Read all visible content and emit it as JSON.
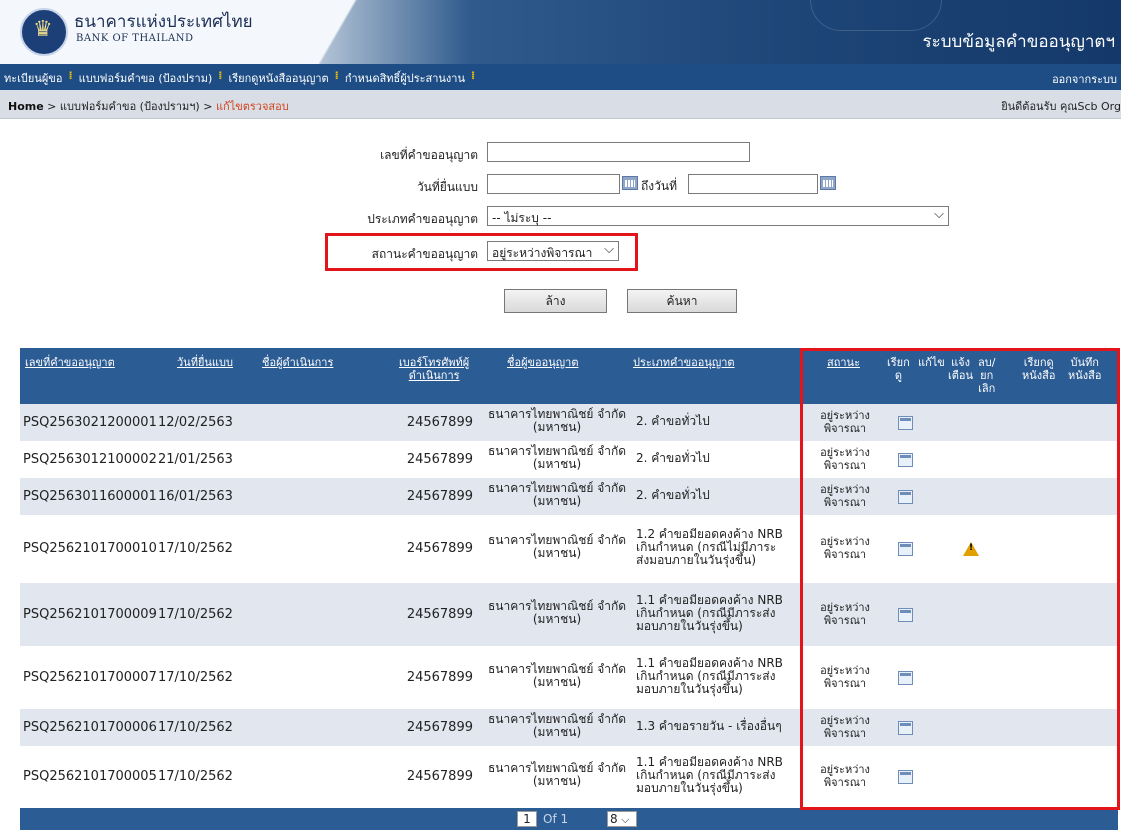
{
  "header": {
    "bank_name_th": "ธนาคารแห่งประเทศไทย",
    "bank_name_en": "BANK OF THAILAND",
    "system_title": "ระบบข้อมูลคำขออนุญาตฯ"
  },
  "nav": {
    "items": [
      "ทะเบียนผู้ขอ",
      "แบบฟอร์มคำขอ (ป้องปราม)",
      "เรียกดูหนังสืออนุญาต",
      "กำหนดสิทธิ์ผู้ประสานงาน"
    ],
    "logout": "ออกจากระบบ"
  },
  "breadcrumb": {
    "home": "Home",
    "sep": " > ",
    "level1": "แบบฟอร์มคำขอ (ป้องปรามฯ)",
    "current": "แก้ไขตรวจสอบ",
    "welcome": "ยินดีต้อนรับ  คุณScb Org"
  },
  "form": {
    "request_no_label": "เลขที่คำขออนุญาต",
    "request_no_value": "",
    "submit_date_label": "วันที่ยื่นแบบ",
    "date_from_value": "",
    "to_date_label": "ถึงวันที่",
    "date_to_value": "",
    "request_type_label": "ประเภทคำขออนุญาต",
    "request_type_value": "-- ไม่ระบุ --",
    "status_label": "สถานะคำขออนุญาต",
    "status_value": "อยู่ระหว่างพิจารณา",
    "clear_button": "ล้าง",
    "search_button": "ค้นหา"
  },
  "table": {
    "headers": {
      "request_no": "เลขที่คำขออนุญาต",
      "submit_date": "วันที่ยื่นแบบ",
      "operator_name": "ชื่อผู้ดำเนินการ",
      "operator_phone_1": "เบอร์โทรศัพท์ผู้",
      "operator_phone_2": "ดำเนินการ",
      "applicant": "ชื่อผู้ขออนุญาต",
      "request_type": "ประเภทคำขออนุญาต",
      "status": "สถานะ",
      "view_1": "เรียก",
      "view_2": "ดู",
      "edit": "แก้ไข",
      "notify_1": "แจ้ง",
      "notify_2": "เตือน",
      "cancel_1": "ลบ/",
      "cancel_2": "ยก",
      "cancel_3": "เลิก",
      "view_letter_1": "เรียกดู",
      "view_letter_2": "หนังสือ",
      "save_letter_1": "บันทึก",
      "save_letter_2": "หนังสือ"
    },
    "rows": [
      {
        "no": "PSQ2563021200001",
        "date": "12/02/2563",
        "phone": "24567899",
        "applicant_1": "ธนาคารไทยพาณิชย์ จำกัด",
        "applicant_2": "(มหาชน)",
        "type_1": "2. คำขอทั่วไป",
        "type_2": "",
        "type_3": "",
        "status_1": "อยู่ระหว่าง",
        "status_2": "พิจารณา",
        "warn": false
      },
      {
        "no": "PSQ2563012100002",
        "date": "21/01/2563",
        "phone": "24567899",
        "applicant_1": "ธนาคารไทยพาณิชย์ จำกัด",
        "applicant_2": "(มหาชน)",
        "type_1": "2. คำขอทั่วไป",
        "type_2": "",
        "type_3": "",
        "status_1": "อยู่ระหว่าง",
        "status_2": "พิจารณา",
        "warn": false
      },
      {
        "no": "PSQ2563011600001",
        "date": "16/01/2563",
        "phone": "24567899",
        "applicant_1": "ธนาคารไทยพาณิชย์ จำกัด",
        "applicant_2": "(มหาชน)",
        "type_1": "2. คำขอทั่วไป",
        "type_2": "",
        "type_3": "",
        "status_1": "อยู่ระหว่าง",
        "status_2": "พิจารณา",
        "warn": false
      },
      {
        "no": "PSQ2562101700010",
        "date": "17/10/2562",
        "phone": "24567899",
        "applicant_1": "ธนาคารไทยพาณิชย์ จำกัด",
        "applicant_2": "(มหาชน)",
        "type_1": "1.2 คำขอมียอดคงค้าง NRB",
        "type_2": "เกินกำหนด (กรณีไม่มีภาระ",
        "type_3": "ส่งมอบภายในวันรุ่งขึ้น)",
        "status_1": "อยู่ระหว่าง",
        "status_2": "พิจารณา",
        "warn": true
      },
      {
        "no": "PSQ2562101700009",
        "date": "17/10/2562",
        "phone": "24567899",
        "applicant_1": "ธนาคารไทยพาณิชย์ จำกัด",
        "applicant_2": "(มหาชน)",
        "type_1": "1.1 คำขอมียอดคงค้าง NRB",
        "type_2": "เกินกำหนด (กรณีมีภาระส่ง",
        "type_3": "มอบภายในวันรุ่งขึ้น)",
        "status_1": "อยู่ระหว่าง",
        "status_2": "พิจารณา",
        "warn": false
      },
      {
        "no": "PSQ2562101700007",
        "date": "17/10/2562",
        "phone": "24567899",
        "applicant_1": "ธนาคารไทยพาณิชย์ จำกัด",
        "applicant_2": "(มหาชน)",
        "type_1": "1.1 คำขอมียอดคงค้าง NRB",
        "type_2": "เกินกำหนด (กรณีมีภาระส่ง",
        "type_3": "มอบภายในวันรุ่งขึ้น)",
        "status_1": "อยู่ระหว่าง",
        "status_2": "พิจารณา",
        "warn": false
      },
      {
        "no": "PSQ2562101700006",
        "date": "17/10/2562",
        "phone": "24567899",
        "applicant_1": "ธนาคารไทยพาณิชย์ จำกัด",
        "applicant_2": "(มหาชน)",
        "type_1": "1.3 คำขอรายวัน - เรื่องอื่นๆ",
        "type_2": "",
        "type_3": "",
        "status_1": "อยู่ระหว่าง",
        "status_2": "พิจารณา",
        "warn": false
      },
      {
        "no": "PSQ2562101700005",
        "date": "17/10/2562",
        "phone": "24567899",
        "applicant_1": "ธนาคารไทยพาณิชย์ จำกัด",
        "applicant_2": "(มหาชน)",
        "type_1": "1.1 คำขอมียอดคงค้าง NRB",
        "type_2": "เกินกำหนด (กรณีมีภาระส่ง",
        "type_3": "มอบภายในวันรุ่งขึ้น)",
        "status_1": "อยู่ระหว่าง",
        "status_2": "พิจารณา",
        "warn": false
      }
    ]
  },
  "pager": {
    "page": "1",
    "of_text": "Of 1",
    "page_size": "8"
  },
  "colors": {
    "header_blue": "#1d4d84",
    "table_header": "#2c5c94",
    "highlight_red": "#e4141b",
    "breadcrumb_current": "#d2451e",
    "row_alt": "#e1e6ef"
  }
}
